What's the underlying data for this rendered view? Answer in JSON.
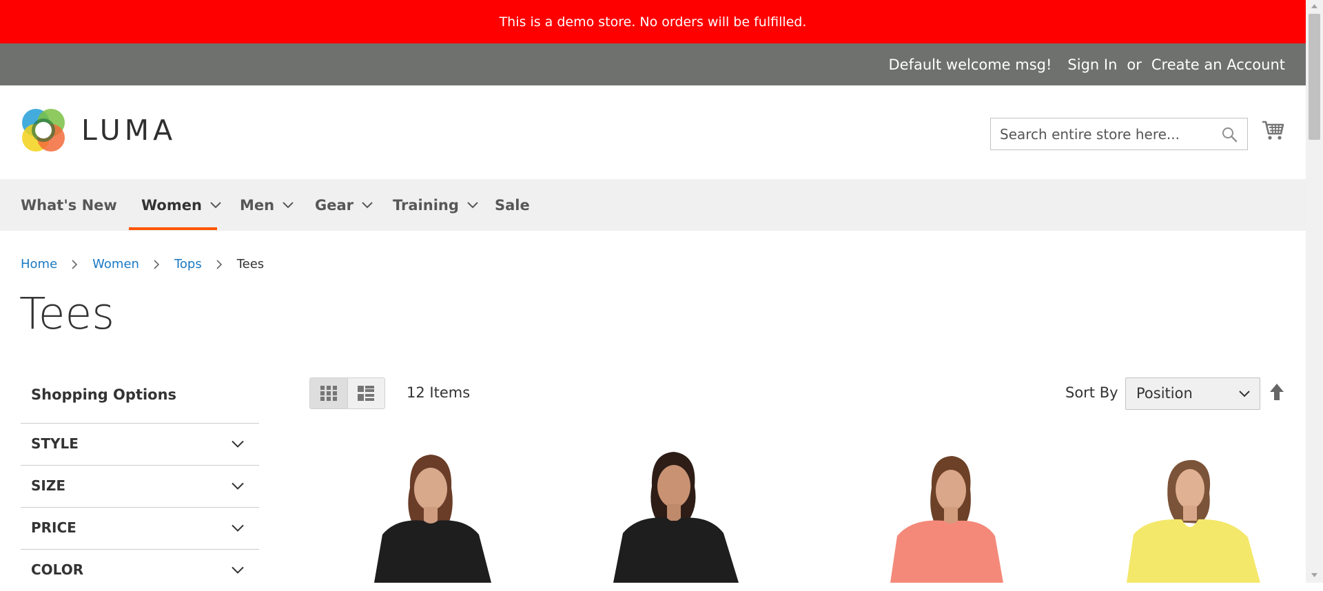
{
  "notice": {
    "text": "This is a demo store. No orders will be fulfilled."
  },
  "panel": {
    "welcome": "Default welcome msg!",
    "sign_in": "Sign In",
    "or": "or",
    "create_account": "Create an Account"
  },
  "logo": {
    "text": "LUMA"
  },
  "search": {
    "placeholder": "Search entire store here..."
  },
  "nav": {
    "items": [
      {
        "label": "What's New",
        "has_dropdown": false,
        "active": false
      },
      {
        "label": "Women",
        "has_dropdown": true,
        "active": true
      },
      {
        "label": "Men",
        "has_dropdown": true,
        "active": false
      },
      {
        "label": "Gear",
        "has_dropdown": true,
        "active": false
      },
      {
        "label": "Training",
        "has_dropdown": true,
        "active": false
      },
      {
        "label": "Sale",
        "has_dropdown": false,
        "active": false
      }
    ]
  },
  "breadcrumbs": {
    "items": [
      "Home",
      "Women",
      "Tops"
    ],
    "current": "Tees"
  },
  "page": {
    "title": "Tees"
  },
  "sidebar": {
    "title": "Shopping Options",
    "filters": [
      "STYLE",
      "SIZE",
      "PRICE",
      "COLOR"
    ]
  },
  "toolbar": {
    "items_count": "12 Items",
    "sort_label": "Sort By",
    "sort_value": "Position"
  },
  "products": [
    {
      "shirt_color": "#1e1e1e"
    },
    {
      "shirt_color": "#1e1e1e"
    },
    {
      "shirt_color": "#f4897a"
    },
    {
      "shirt_color": "#f3e86a"
    }
  ],
  "colors": {
    "notice_bg": "#ff0000",
    "panel_bg": "#6e716e",
    "nav_bg": "#f0f0f0",
    "nav_active_underline": "#ff5501",
    "link": "#1979c3"
  }
}
